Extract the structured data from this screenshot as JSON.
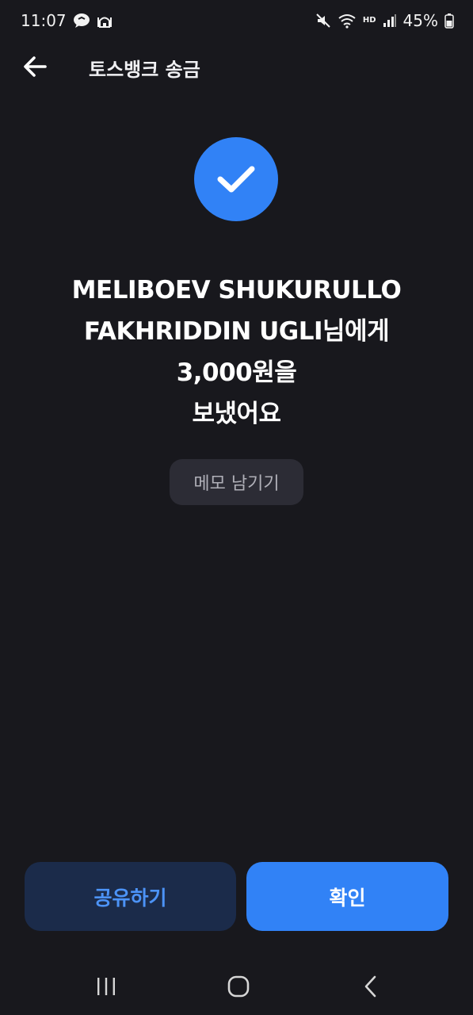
{
  "status_bar": {
    "time": "11:07",
    "battery_percent": "45%",
    "hd_label": "HD",
    "icons": [
      "chat-bubble-icon",
      "mosque-icon",
      "mute-icon",
      "wifi-icon",
      "hd-voice-icon",
      "signal-icon",
      "battery-icon"
    ]
  },
  "header": {
    "title": "토스뱅크 송금",
    "back_icon": "arrow-left-icon"
  },
  "success": {
    "icon": "checkmark-icon",
    "accent_color": "#3182f6",
    "lines": [
      "MELIBOEV SHUKURULLO",
      "FAKHRIDDIN UGLI님에게",
      "3,000원을",
      "보냈어요"
    ]
  },
  "memo_button_label": "메모 남기기",
  "actions": {
    "share_label": "공유하기",
    "confirm_label": "확인"
  },
  "nav_bar": {
    "icons": [
      "recents-icon",
      "home-icon",
      "back-icon"
    ]
  }
}
